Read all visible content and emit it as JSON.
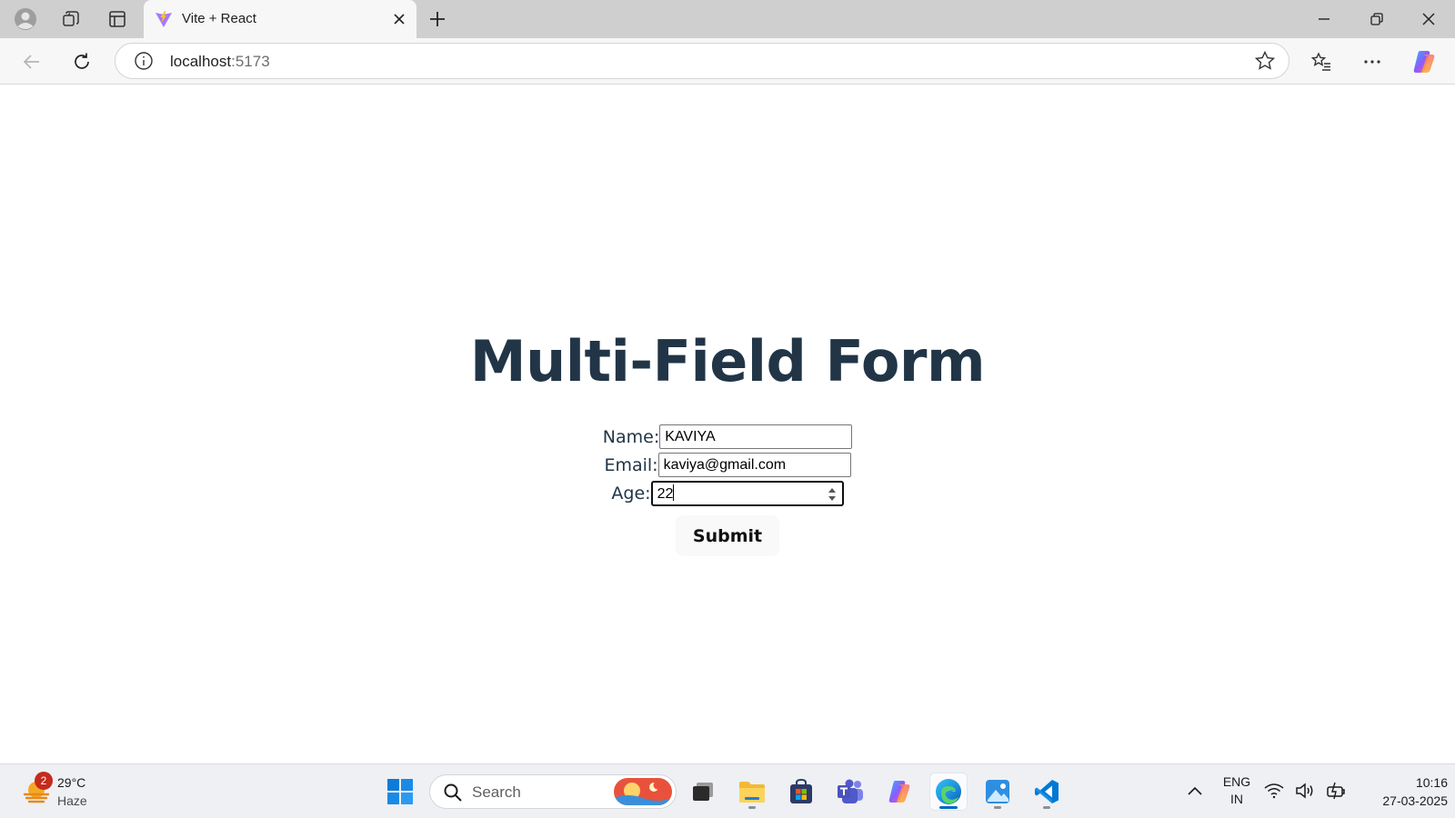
{
  "browser": {
    "tab_title": "Vite + React",
    "url_host": "localhost",
    "url_port": ":5173"
  },
  "page": {
    "title": "Multi-Field Form",
    "fields": {
      "name": {
        "label": "Name:",
        "value": "KAVIYA"
      },
      "email": {
        "label": "Email:",
        "value": "kaviya@gmail.com"
      },
      "age": {
        "label": "Age:",
        "value": "22"
      }
    },
    "submit_label": "Submit"
  },
  "taskbar": {
    "weather": {
      "badge_count": "2",
      "temperature": "29°C",
      "condition": "Haze"
    },
    "search_placeholder": "Search",
    "tray": {
      "lang_primary": "ENG",
      "lang_secondary": "IN",
      "time": "10:16",
      "date": "27-03-2025"
    }
  },
  "colors": {
    "heading": "#213547",
    "accent": "#0067c0",
    "vscode_blue": "#0078d4"
  }
}
